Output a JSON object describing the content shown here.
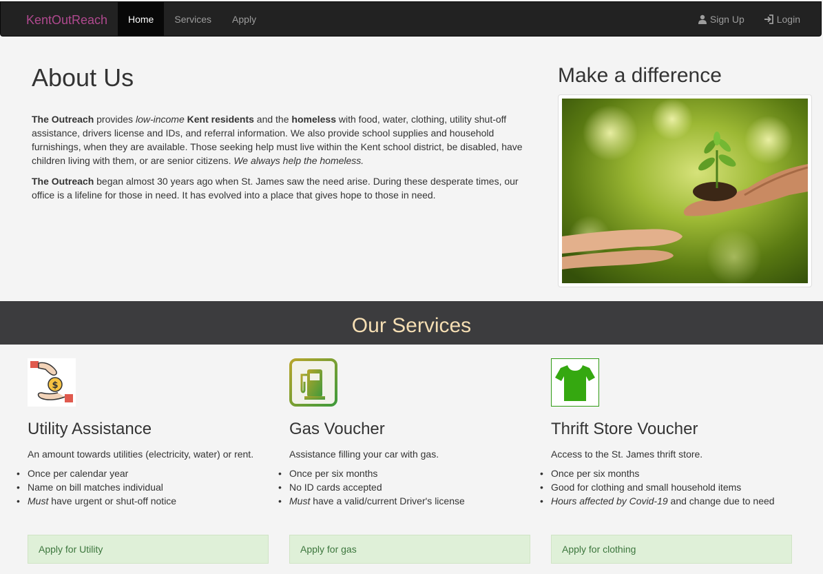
{
  "navbar": {
    "brand": "KentOutReach",
    "links": [
      {
        "label": "Home",
        "active": true
      },
      {
        "label": "Services",
        "active": false
      },
      {
        "label": "Apply",
        "active": false
      }
    ],
    "signup_label": "Sign Up",
    "login_label": "Login"
  },
  "about": {
    "title": "About Us",
    "p1": {
      "b1": "The Outreach",
      "t1": " provides ",
      "i1": "low-income",
      "t2": " ",
      "b2": "Kent residents",
      "t3": " and the ",
      "b3": "homeless",
      "t4": " with food, water, clothing, utility shut-off assistance, drivers license and IDs, and referral information. We also provide school supplies and household furnishings, when they are available. Those seeking help must live within the Kent school district, be disabled, have children living with them, or are senior citizens. ",
      "i2": "We always help the homeless."
    },
    "p2": {
      "b1": "The Outreach",
      "t1": " began almost 30 years ago when St. James saw the need arise. During these desperate times, our office is a lifeline for those in need. It has evolved into a place that gives hope to those in need."
    }
  },
  "difference": {
    "title": "Make a difference"
  },
  "services": {
    "heading": "Our Services",
    "items": [
      {
        "title": "Utility Assistance",
        "desc": "An amount towards utilities (electricity, water) or rent.",
        "li1": "Once per calendar year",
        "li2": "Name on bill matches individual",
        "li3_em": "Must",
        "li3_rest": " have urgent or shut-off notice",
        "button": "Apply for Utility"
      },
      {
        "title": "Gas Voucher",
        "desc": "Assistance filling your car with gas.",
        "li1": "Once per six months",
        "li2": "No ID cards accepted",
        "li3_em": "Must",
        "li3_rest": " have a valid/current Driver's license",
        "button": "Apply for gas"
      },
      {
        "title": "Thrift Store Voucher",
        "desc": "Access to the St. James thrift store.",
        "li1": "Once per six months",
        "li2": "Good for clothing and small household items",
        "li3_em": "Hours affected by Covid-19",
        "li3_rest": " and change due to need",
        "button": "Apply for clothing"
      }
    ]
  },
  "colors": {
    "brand": "#b0498f",
    "navbar": "#222222",
    "banner": "#3c3c3e",
    "banner_text": "#f5deb3",
    "apply_bg": "#dff0d8",
    "apply_text": "#3c763d"
  }
}
